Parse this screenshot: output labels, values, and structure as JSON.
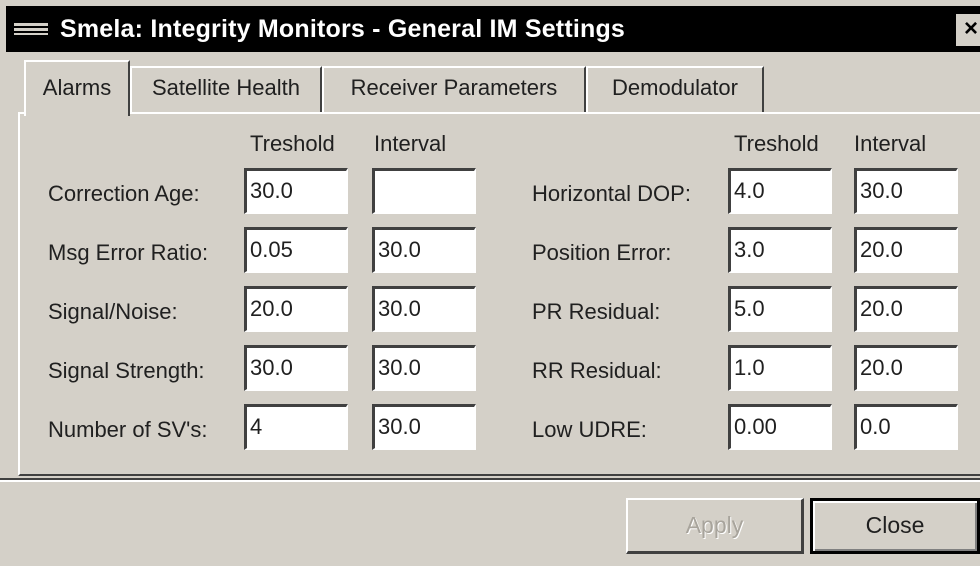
{
  "window": {
    "title": "Smela: Integrity Monitors - General IM Settings",
    "close_glyph": "×"
  },
  "tabs": [
    {
      "label": "Alarms",
      "active": true
    },
    {
      "label": "Satellite Health",
      "active": false
    },
    {
      "label": "Receiver Parameters",
      "active": false
    },
    {
      "label": "Demodulator",
      "active": false
    }
  ],
  "alarms": {
    "threshold_header": "Treshold",
    "interval_header": "Interval",
    "left_rows": [
      {
        "label": "Correction Age:",
        "threshold": "30.0",
        "interval": ""
      },
      {
        "label": "Msg Error Ratio:",
        "threshold": "0.05",
        "interval": "30.0"
      },
      {
        "label": "Signal/Noise:",
        "threshold": "20.0",
        "interval": "30.0"
      },
      {
        "label": "Signal Strength:",
        "threshold": "30.0",
        "interval": "30.0"
      },
      {
        "label": "Number of SV's:",
        "threshold": "4",
        "interval": "30.0"
      }
    ],
    "right_rows": [
      {
        "label": "Horizontal DOP:",
        "threshold": "4.0",
        "interval": "30.0"
      },
      {
        "label": "Position Error:",
        "threshold": "3.0",
        "interval": "20.0"
      },
      {
        "label": "PR Residual:",
        "threshold": "5.0",
        "interval": "20.0"
      },
      {
        "label": "RR Residual:",
        "threshold": "1.0",
        "interval": "20.0"
      },
      {
        "label": "Low UDRE:",
        "threshold": "0.00",
        "interval": "0.0"
      }
    ]
  },
  "buttons": {
    "apply": "Apply",
    "close": "Close"
  },
  "colors": {
    "face": "#d4d0c8",
    "titlebar": "#000000",
    "field": "#ffffff"
  }
}
